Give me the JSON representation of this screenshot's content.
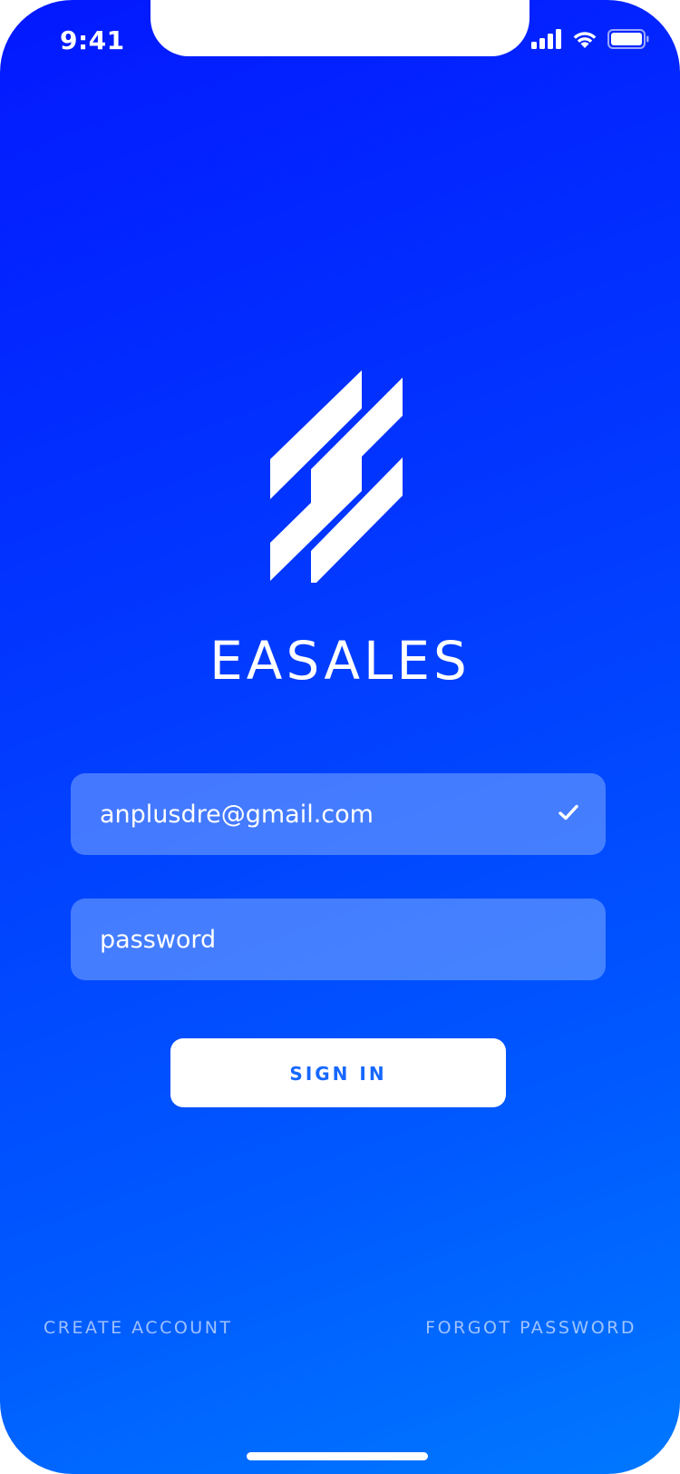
{
  "status_bar": {
    "time": "9:41",
    "signal_icon": "cellular-signal-icon",
    "wifi_icon": "wifi-icon",
    "battery_icon": "battery-icon"
  },
  "brand": {
    "logo_icon": "easales-logo-icon",
    "name": "EASALES"
  },
  "form": {
    "email_value": "anplusdre@gmail.com",
    "email_valid_icon": "check-icon",
    "password_placeholder": "password",
    "sign_in_label": "SIGN IN"
  },
  "footer": {
    "create_account": "CREATE ACCOUNT",
    "forgot_password": "FORGOT PASSWORD"
  },
  "colors": {
    "gradient_top": "#0318ff",
    "gradient_bottom": "#0078ff",
    "button_text": "#1668ff",
    "field_background": "rgba(150,190,255,0.45)"
  }
}
